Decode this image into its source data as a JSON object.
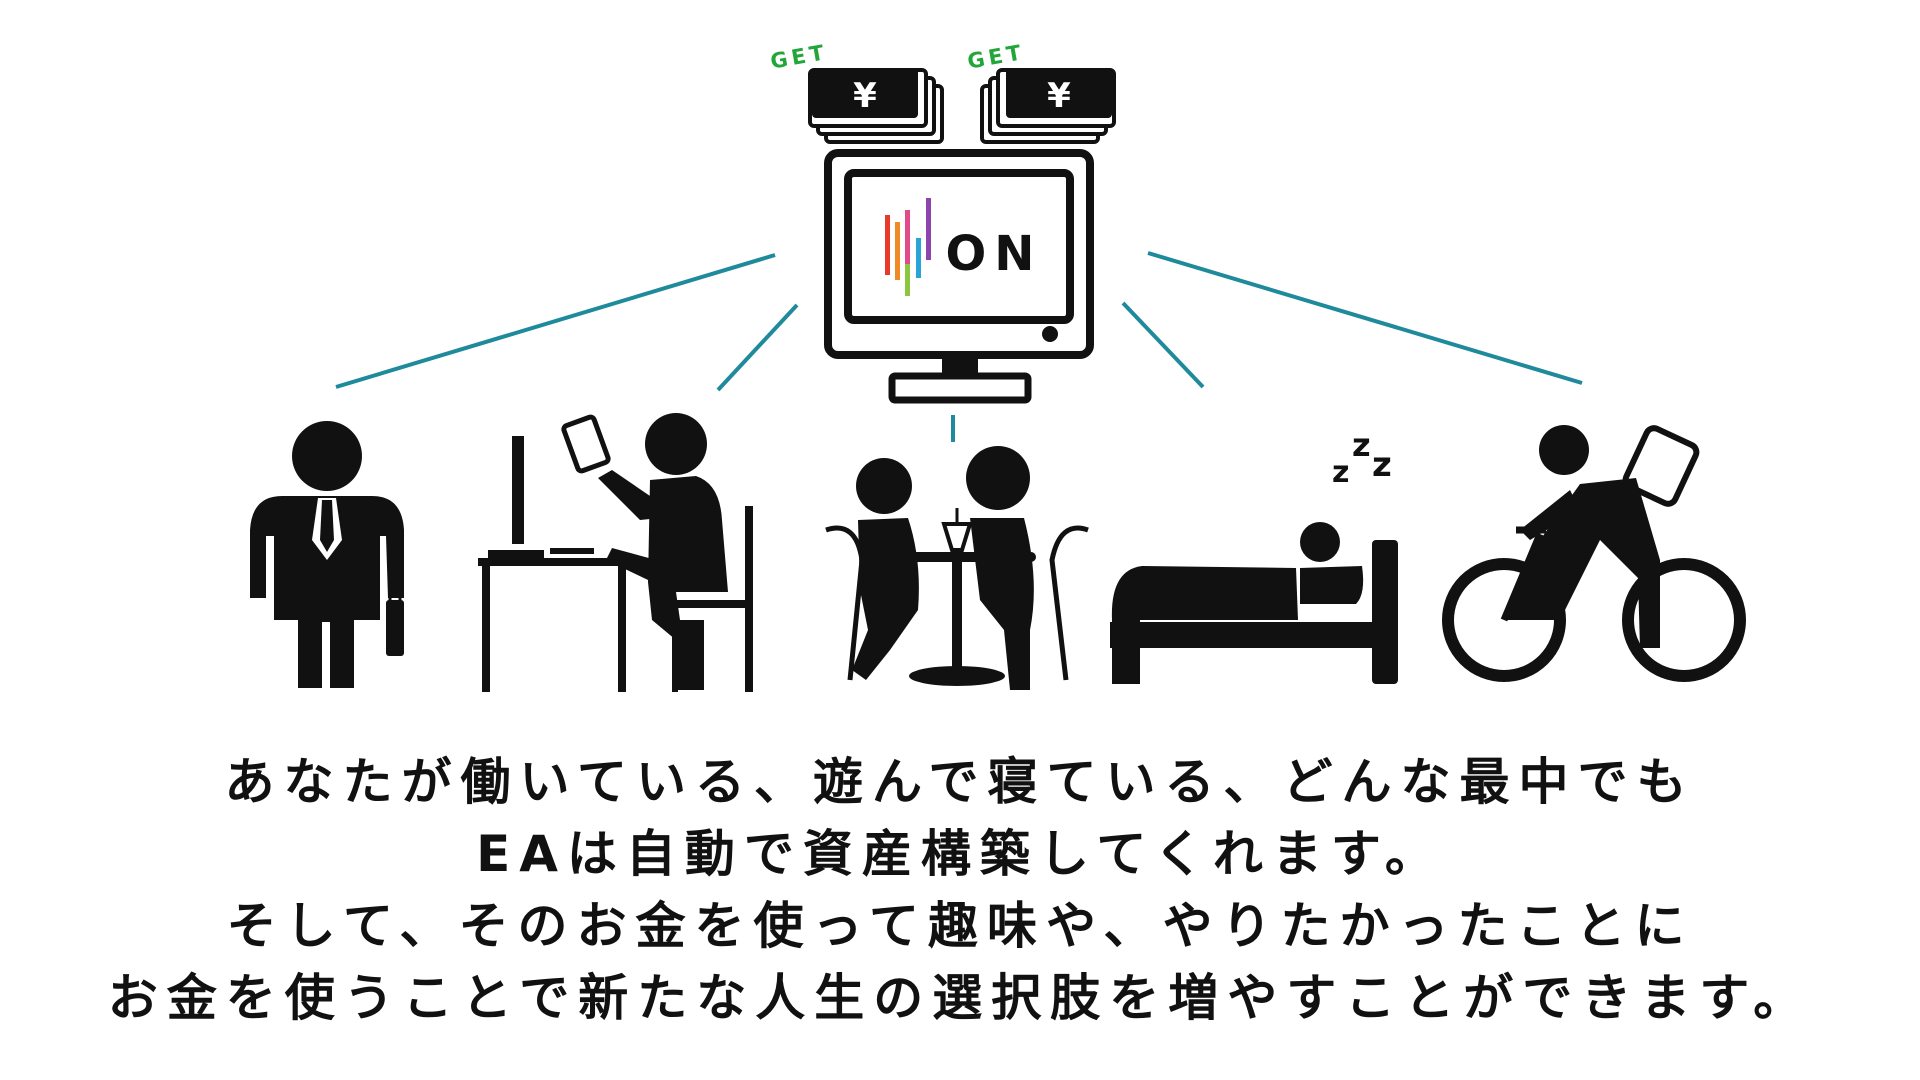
{
  "badges": {
    "left": {
      "label": "GET",
      "currency": "¥"
    },
    "right": {
      "label": "GET",
      "currency": "¥"
    }
  },
  "monitor": {
    "status_text": "ON",
    "bar_colors": [
      "#e8392b",
      "#f08a24",
      "#e24a8b",
      "#8cc63f",
      "#29a3d8",
      "#8e44ad"
    ]
  },
  "colors": {
    "accent_line": "#1f8a9c",
    "badge_green": "#22a63a",
    "ink": "#111111"
  },
  "figures": [
    "businessman",
    "desk-worker",
    "cafe-couple",
    "sleeper",
    "cyclist"
  ],
  "caption": {
    "line1": "あなたが働いている、遊んで寝ている、どんな最中でも",
    "line2": "EAは自動で資産構築してくれます。",
    "line3": "そして、そのお金を使って趣味や、やりたかったことに",
    "line4": "お金を使うことで新たな人生の選択肢を増やすことができます。"
  }
}
